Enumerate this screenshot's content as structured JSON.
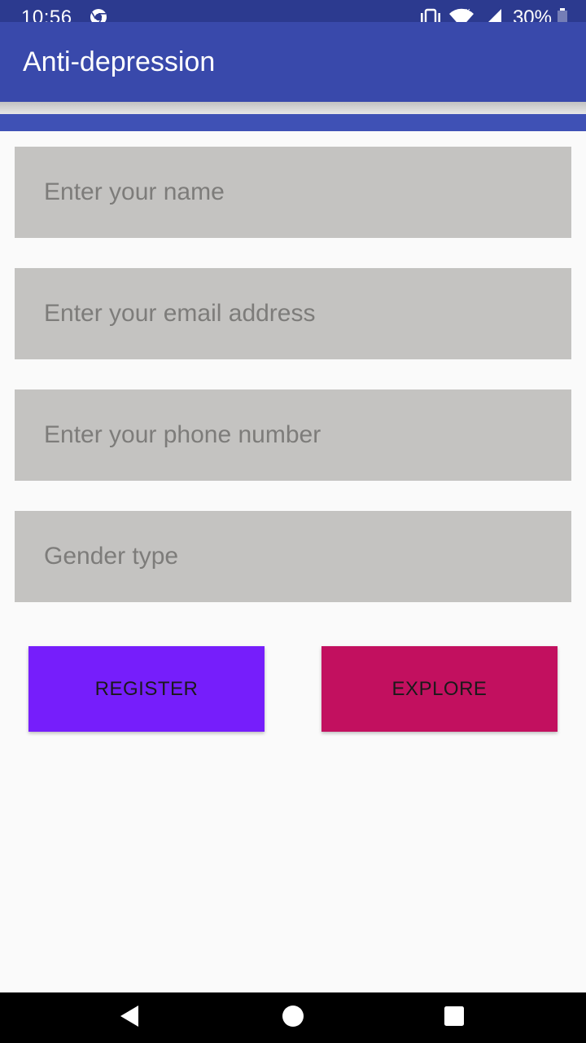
{
  "status_bar": {
    "time": "10:56",
    "battery": "30%",
    "icons": [
      "chrome-icon",
      "vibrate-icon",
      "wifi-icon",
      "signal-icon",
      "battery-icon"
    ]
  },
  "app_bar": {
    "title": "Anti-depression"
  },
  "form": {
    "name_placeholder": "Enter your name",
    "email_placeholder": "Enter your email address",
    "phone_placeholder": "Enter your phone number",
    "gender_placeholder": "Gender type"
  },
  "buttons": {
    "register_label": "REGISTER",
    "explore_label": "EXPLORE"
  },
  "nav_bar": {
    "icons": [
      "back-icon",
      "home-icon",
      "recents-icon"
    ]
  },
  "colors": {
    "status_bar": "#2c3a8f",
    "app_bar": "#3949ab",
    "accent_strip": "#3f51b5",
    "input_background": "#c4c3c1",
    "register_button": "#761efb",
    "explore_button": "#c2105f",
    "background": "#fafafa"
  }
}
